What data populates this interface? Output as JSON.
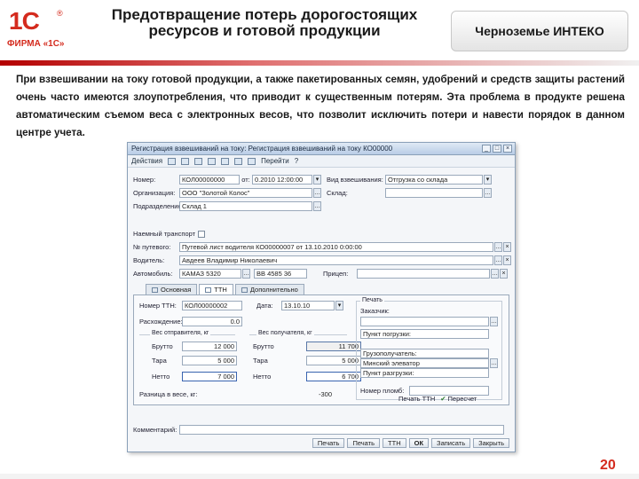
{
  "logo": {
    "mark": "1С",
    "reg": "®",
    "text": "ФИРМА «1С»"
  },
  "slide": {
    "title": "Предотвращение потерь дорогостоящих ресурсов и готовой продукции",
    "company": "Черноземье ИНТЕКО",
    "description": "При взвешивании на току готовой продукции, а также пакетированных семян, удобрений и средств защиты растений очень часто имеются злоупотребления, что приводит к существенным потерям. Эта проблема в продукте решена автоматическим съемом веса с электронных весов, что позволит исключить потери и навести порядок в данном центре учета.",
    "page_number": "20"
  },
  "window": {
    "title": "Регистрация взвешиваний на току: Регистрация взвешиваний на току КО00000",
    "toolbar": {
      "actions": "Действия",
      "goto": "Перейти",
      "help": "?"
    },
    "fields": {
      "number_label": "Номер:",
      "number_value": "КОЛ00000000",
      "from_label": "от:",
      "from_value": "0.2010 12:00:00",
      "weigh_type_label": "Вид взвешивания:",
      "weigh_type_value": "Отгрузка со склада",
      "org_label": "Организация:",
      "org_value": "ООО \"Золотой Колос\"",
      "warehouse_label": "Склад:",
      "division_label": "Подразделение:",
      "division_value": "Склад 1",
      "hired_transport_label": "Наемный транспорт",
      "ttn_label": "№ путевого:",
      "ttn_value": "Путевой лист водителя КО00000007 от 13.10.2010 0:00:00",
      "driver_label": "Водитель:",
      "driver_value": "Авдеев Владимир Николаевич",
      "car_label": "Автомобиль:",
      "car_value": "КАМАЗ 5320",
      "car_plate": "ВВ 4585 36",
      "trailer_label": "Прицеп:"
    },
    "tabs": [
      "Основная",
      "ТТН",
      "Дополнительно"
    ],
    "panel": {
      "ttn_number_label": "Номер ТТН:",
      "ttn_number_value": "КОЛ00000002",
      "date_label": "Дата:",
      "date_value": "13.10.10",
      "discrepancy_label": "Расхождение:",
      "discrepancy_value": "0.0",
      "sender_group": "Вес отправителя, кг",
      "receiver_group": "Вес получателя, кг",
      "gross_label": "Брутто",
      "tare_label": "Тара",
      "net_label": "Нетто",
      "sender_gross": "12 000",
      "sender_tare": "5 000",
      "sender_net": "7 000",
      "receiver_gross": "11 700",
      "receiver_tare": "5 000",
      "receiver_net": "6 700",
      "diff_label": "Разница в весе, кг:",
      "diff_value": "-300",
      "print_group": "Печать",
      "customer_label": "Заказчик:",
      "loading_point_label": "Пункт погрузки:",
      "consignee_label": "Грузополучатель:",
      "consignee_value": "Минский элеватор",
      "unloading_point_label": "Пункт разгрузки:",
      "seal_label": "Номер пломб:",
      "print_ttn": "Печать ТТН",
      "recalc": "Пересчет"
    },
    "comment_label": "Комментарий:",
    "buttons": [
      "Печать",
      "Печать",
      "ТТН",
      "ОК",
      "Записать",
      "Закрыть"
    ]
  }
}
